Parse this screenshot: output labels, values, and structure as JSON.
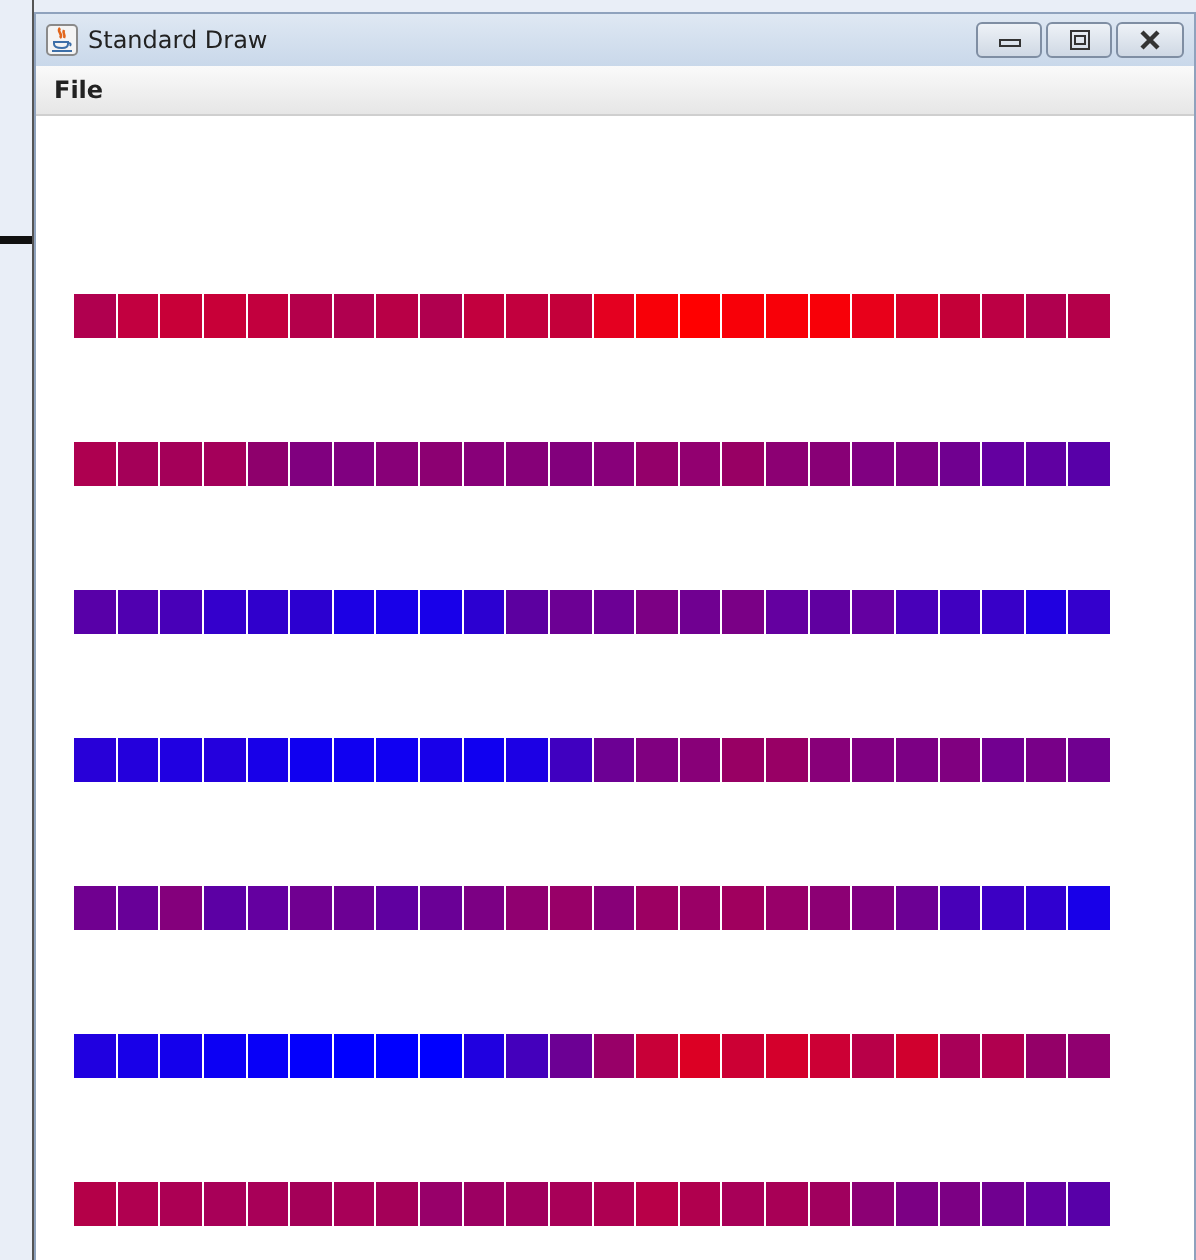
{
  "window": {
    "title": "Standard Draw"
  },
  "menu_bar": [
    {
      "label": "File"
    }
  ],
  "canvas": {
    "rows": [
      {
        "squares": [
          {
            "color": "#b0004f"
          },
          {
            "color": "#c20040"
          },
          {
            "color": "#c80038"
          },
          {
            "color": "#c80038"
          },
          {
            "color": "#c2003e"
          },
          {
            "color": "#b4004b"
          },
          {
            "color": "#b0004f"
          },
          {
            "color": "#b80046"
          },
          {
            "color": "#b0004f"
          },
          {
            "color": "#c2003e"
          },
          {
            "color": "#c2003e"
          },
          {
            "color": "#c4003a"
          },
          {
            "color": "#e40020"
          },
          {
            "color": "#f80008"
          },
          {
            "color": "#ff0000"
          },
          {
            "color": "#f80008"
          },
          {
            "color": "#f80008"
          },
          {
            "color": "#f80008"
          },
          {
            "color": "#e8001a"
          },
          {
            "color": "#d8002a"
          },
          {
            "color": "#c40038"
          },
          {
            "color": "#bc0044"
          },
          {
            "color": "#b0004f"
          },
          {
            "color": "#b4004a"
          }
        ]
      },
      {
        "squares": [
          {
            "color": "#ae0050"
          },
          {
            "color": "#a40058"
          },
          {
            "color": "#a40059"
          },
          {
            "color": "#a4005a"
          },
          {
            "color": "#8e006c"
          },
          {
            "color": "#80007f"
          },
          {
            "color": "#800080"
          },
          {
            "color": "#880078"
          },
          {
            "color": "#8c0072"
          },
          {
            "color": "#880079"
          },
          {
            "color": "#860078"
          },
          {
            "color": "#82007c"
          },
          {
            "color": "#88007a"
          },
          {
            "color": "#94006a"
          },
          {
            "color": "#920070"
          },
          {
            "color": "#980064"
          },
          {
            "color": "#8c0073"
          },
          {
            "color": "#880076"
          },
          {
            "color": "#800081"
          },
          {
            "color": "#7e0082"
          },
          {
            "color": "#700090"
          },
          {
            "color": "#6400a0"
          },
          {
            "color": "#6000a2"
          },
          {
            "color": "#5800a8"
          }
        ]
      },
      {
        "squares": [
          {
            "color": "#5800a8"
          },
          {
            "color": "#5000b0"
          },
          {
            "color": "#4800b8"
          },
          {
            "color": "#3400cc"
          },
          {
            "color": "#3000cc"
          },
          {
            "color": "#2c00d0"
          },
          {
            "color": "#1c00e4"
          },
          {
            "color": "#1800e8"
          },
          {
            "color": "#1800e9"
          },
          {
            "color": "#2c00d1"
          },
          {
            "color": "#5c00a0"
          },
          {
            "color": "#6c0094"
          },
          {
            "color": "#6c0095"
          },
          {
            "color": "#7c0084"
          },
          {
            "color": "#700091"
          },
          {
            "color": "#7a0086"
          },
          {
            "color": "#6400a0"
          },
          {
            "color": "#6000a0"
          },
          {
            "color": "#6400a1"
          },
          {
            "color": "#4800b9"
          },
          {
            "color": "#4000c0"
          },
          {
            "color": "#3800c8"
          },
          {
            "color": "#2000e0"
          },
          {
            "color": "#3400cd"
          }
        ]
      },
      {
        "squares": [
          {
            "color": "#2800d8"
          },
          {
            "color": "#2400dc"
          },
          {
            "color": "#2000e1"
          },
          {
            "color": "#2400dd"
          },
          {
            "color": "#1800e8"
          },
          {
            "color": "#1000f0"
          },
          {
            "color": "#1000f1"
          },
          {
            "color": "#1000f2"
          },
          {
            "color": "#1800e9"
          },
          {
            "color": "#1000f0"
          },
          {
            "color": "#1c00e4"
          },
          {
            "color": "#4000c0"
          },
          {
            "color": "#6c0094"
          },
          {
            "color": "#800080"
          },
          {
            "color": "#880078"
          },
          {
            "color": "#980064"
          },
          {
            "color": "#980065"
          },
          {
            "color": "#880079"
          },
          {
            "color": "#800081"
          },
          {
            "color": "#7c0084"
          },
          {
            "color": "#800080"
          },
          {
            "color": "#720090"
          },
          {
            "color": "#780088"
          },
          {
            "color": "#700090"
          }
        ]
      },
      {
        "squares": [
          {
            "color": "#700090"
          },
          {
            "color": "#680098"
          },
          {
            "color": "#84007c"
          },
          {
            "color": "#5c00a4"
          },
          {
            "color": "#6400a0"
          },
          {
            "color": "#700091"
          },
          {
            "color": "#6c0094"
          },
          {
            "color": "#6000a0"
          },
          {
            "color": "#6a0096"
          },
          {
            "color": "#7c0084"
          },
          {
            "color": "#900070"
          },
          {
            "color": "#980068"
          },
          {
            "color": "#880078"
          },
          {
            "color": "#9c0062"
          },
          {
            "color": "#9a0066"
          },
          {
            "color": "#a0005e"
          },
          {
            "color": "#980069"
          },
          {
            "color": "#8c0074"
          },
          {
            "color": "#800080"
          },
          {
            "color": "#6c0094"
          },
          {
            "color": "#4800b8"
          },
          {
            "color": "#3c00c4"
          },
          {
            "color": "#3000d0"
          },
          {
            "color": "#1800e8"
          }
        ]
      },
      {
        "squares": [
          {
            "color": "#2000e0"
          },
          {
            "color": "#1800e8"
          },
          {
            "color": "#1400ec"
          },
          {
            "color": "#0c00f4"
          },
          {
            "color": "#0800f8"
          },
          {
            "color": "#0400fc"
          },
          {
            "color": "#0000ff"
          },
          {
            "color": "#0000ff"
          },
          {
            "color": "#0000ff"
          },
          {
            "color": "#2000e0"
          },
          {
            "color": "#4400bc"
          },
          {
            "color": "#6c0094"
          },
          {
            "color": "#980068"
          },
          {
            "color": "#c80038"
          },
          {
            "color": "#dc0024"
          },
          {
            "color": "#cc0034"
          },
          {
            "color": "#d4002c"
          },
          {
            "color": "#cc0035"
          },
          {
            "color": "#b80048"
          },
          {
            "color": "#d0002e"
          },
          {
            "color": "#a80058"
          },
          {
            "color": "#b0004f"
          },
          {
            "color": "#940068"
          },
          {
            "color": "#900070"
          }
        ]
      },
      {
        "squares": [
          {
            "color": "#b40048"
          },
          {
            "color": "#b00050"
          },
          {
            "color": "#ac0054"
          },
          {
            "color": "#a80058"
          },
          {
            "color": "#a80058"
          },
          {
            "color": "#a40058"
          },
          {
            "color": "#a80058"
          },
          {
            "color": "#a40058"
          },
          {
            "color": "#98006a"
          },
          {
            "color": "#9c0062"
          },
          {
            "color": "#a0005e"
          },
          {
            "color": "#a80058"
          },
          {
            "color": "#ae0052"
          },
          {
            "color": "#b80048"
          },
          {
            "color": "#b0004e"
          },
          {
            "color": "#a80058"
          },
          {
            "color": "#a80056"
          },
          {
            "color": "#a0005e"
          },
          {
            "color": "#8c0074"
          },
          {
            "color": "#7c0084"
          },
          {
            "color": "#7c0084"
          },
          {
            "color": "#700090"
          },
          {
            "color": "#6400a0"
          },
          {
            "color": "#5800a8"
          }
        ]
      }
    ]
  }
}
